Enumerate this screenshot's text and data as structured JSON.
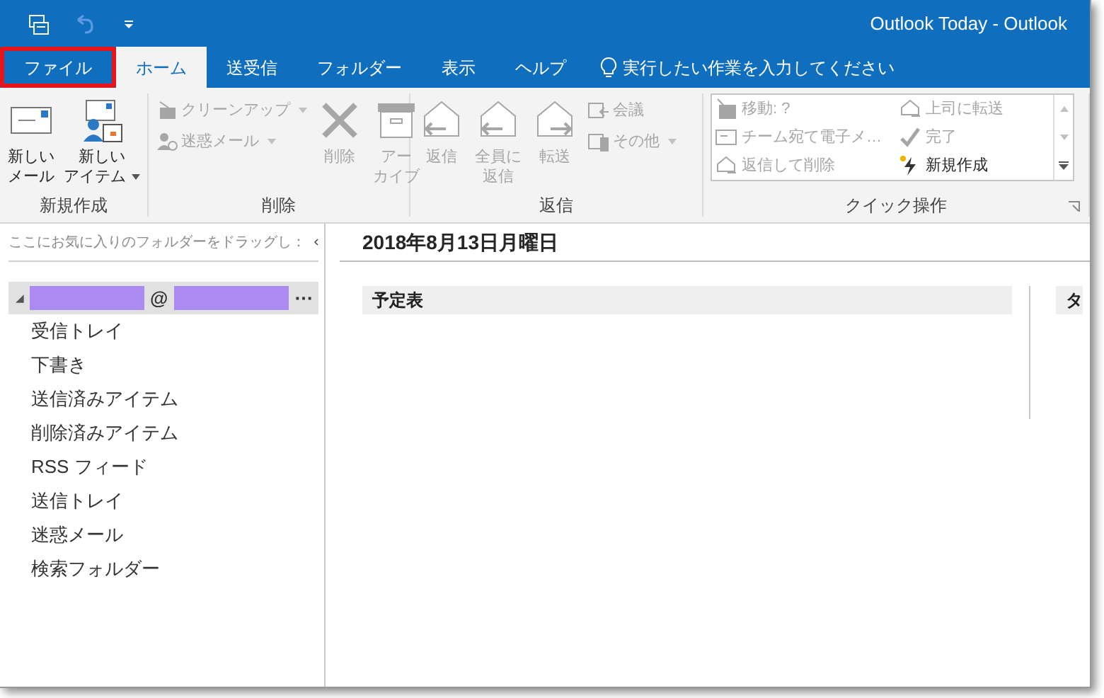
{
  "window": {
    "title": "Outlook Today  -  Outlook"
  },
  "quick_access": [
    {
      "kind": "sendrecv",
      "disabled": false
    },
    {
      "kind": "undo",
      "disabled": true
    },
    {
      "kind": "customize",
      "disabled": false
    }
  ],
  "tabs": [
    {
      "label": "ファイル",
      "selected": false,
      "highlighted": true
    },
    {
      "label": "ホーム",
      "selected": true,
      "highlighted": false
    },
    {
      "label": "送受信",
      "selected": false,
      "highlighted": false
    },
    {
      "label": "フォルダー",
      "selected": false,
      "highlighted": false
    },
    {
      "label": "表示",
      "selected": false,
      "highlighted": false
    },
    {
      "label": "ヘルプ",
      "selected": false,
      "highlighted": false
    }
  ],
  "tell_me": {
    "placeholder": "実行したい作業を入力してください"
  },
  "ribbon": {
    "groups": [
      {
        "label": "新規作成",
        "items": [
          {
            "kind": "large",
            "lines": [
              "新しい",
              "メール"
            ],
            "disabled": false,
            "dropdown": false
          },
          {
            "kind": "large",
            "lines": [
              "新しい",
              "アイテム"
            ],
            "disabled": false,
            "dropdown": true
          }
        ]
      },
      {
        "label": "削除",
        "items": [
          {
            "kind": "stack",
            "children": [
              {
                "label": "クリーンアップ",
                "disabled": true,
                "dropdown": true
              },
              {
                "label": "迷惑メール",
                "disabled": true,
                "dropdown": true
              }
            ]
          },
          {
            "kind": "large",
            "lines": [
              "削除"
            ],
            "disabled": true,
            "dropdown": false
          },
          {
            "kind": "large",
            "lines": [
              "アー",
              "カイブ"
            ],
            "disabled": true,
            "dropdown": false
          }
        ]
      },
      {
        "label": "返信",
        "items": [
          {
            "kind": "large",
            "lines": [
              "返信"
            ],
            "disabled": true,
            "dropdown": false
          },
          {
            "kind": "large",
            "lines": [
              "全員に",
              "返信"
            ],
            "disabled": true,
            "dropdown": false
          },
          {
            "kind": "large",
            "lines": [
              "転送"
            ],
            "disabled": true,
            "dropdown": false
          },
          {
            "kind": "stack",
            "children": [
              {
                "label": "会議",
                "disabled": true,
                "dropdown": false
              },
              {
                "label": "その他",
                "disabled": true,
                "dropdown": true
              }
            ]
          }
        ]
      },
      {
        "label": "クイック操作",
        "items": [
          {
            "kind": "gallery",
            "children": [
              {
                "label": "移動: ?",
                "disabled": true
              },
              {
                "label": "上司に転送",
                "disabled": true
              },
              {
                "label": "チーム宛て電子メ…",
                "disabled": true
              },
              {
                "label": "完了",
                "disabled": true
              },
              {
                "label": "返信して削除",
                "disabled": true
              },
              {
                "label": "新規作成",
                "disabled": false
              }
            ]
          }
        ]
      }
    ]
  },
  "folder_pane": {
    "favorites_hint": "ここにお気に入りのフォルダーをドラッグし：",
    "account": {
      "at": "@",
      "more": "⋯",
      "expanded": true
    },
    "folders": [
      {
        "label": "受信トレイ"
      },
      {
        "label": "下書き"
      },
      {
        "label": "送信済みアイテム"
      },
      {
        "label": "削除済みアイテム"
      },
      {
        "label": "RSS フィード"
      },
      {
        "label": "送信トレイ"
      },
      {
        "label": "迷惑メール"
      },
      {
        "label": "検索フォルダー"
      }
    ]
  },
  "today": {
    "date": "2018年8月13日月曜日",
    "columns": [
      {
        "label": "予定表"
      },
      {
        "label": "タ"
      }
    ]
  }
}
